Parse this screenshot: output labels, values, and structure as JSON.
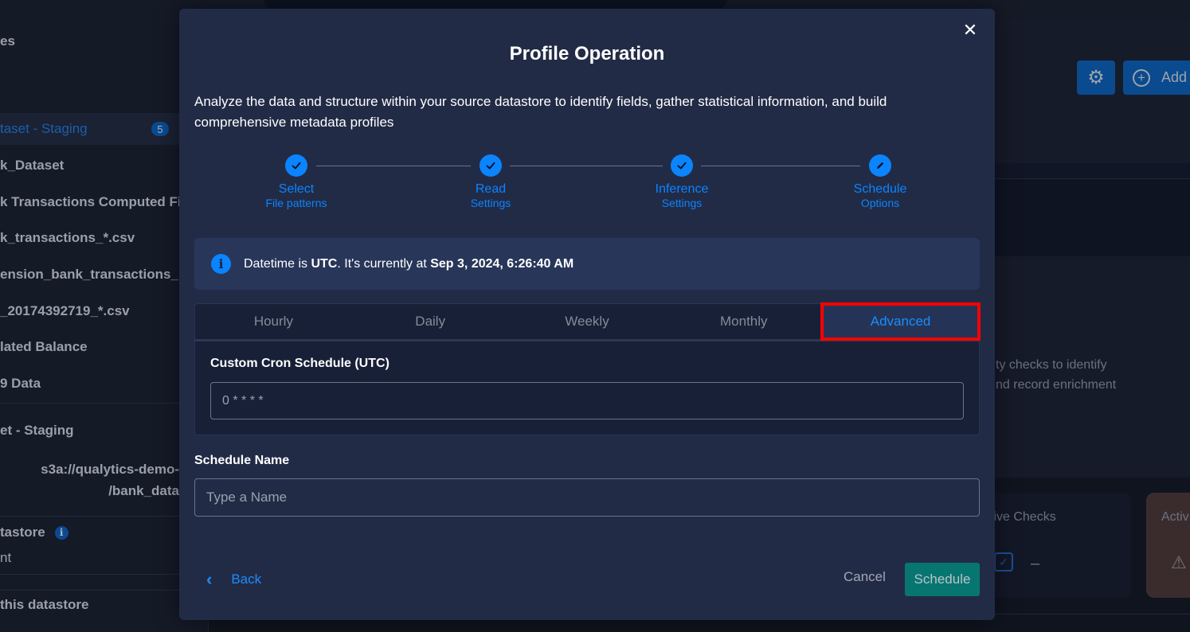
{
  "background": {
    "sidebar": {
      "items": [
        {
          "label": "es"
        },
        {
          "label": "taset - Staging",
          "badge": "5",
          "active": true
        },
        {
          "label": "k_Dataset"
        },
        {
          "label": "k Transactions Computed Fil"
        },
        {
          "label": "k_transactions_*.csv"
        },
        {
          "label": "ension_bank_transactions_"
        },
        {
          "label": "_20174392719_*.csv"
        },
        {
          "label": "lated Balance"
        },
        {
          "label": "9 Data"
        },
        {
          "label": "et - Staging"
        }
      ],
      "path_line1": "s3a://qualytics-demo-",
      "path_line2": "/bank_data",
      "datastore_label": "tastore",
      "datastore_value": "nt",
      "footer_label": "this datastore",
      "info_glyph": "i"
    },
    "toolbar": {
      "settings_icon": "gear-icon",
      "add_label": "Add"
    },
    "description_line1": "ty checks to identify",
    "description_line2": "nd record enrichment",
    "cards": [
      {
        "title": "ctive Checks",
        "value": "–",
        "icon": "checkbox-icon"
      },
      {
        "title": "Activ",
        "icon": "warning-icon"
      }
    ]
  },
  "modal": {
    "title": "Profile Operation",
    "close_glyph": "✕",
    "description": "Analyze the data and structure within your source datastore to identify fields, gather statistical information, and build comprehensive metadata profiles",
    "steps": [
      {
        "label": "Select",
        "sub": "File patterns",
        "status": "complete"
      },
      {
        "label": "Read",
        "sub": "Settings",
        "status": "complete"
      },
      {
        "label": "Inference",
        "sub": "Settings",
        "status": "complete"
      },
      {
        "label": "Schedule",
        "sub": "Options",
        "status": "current"
      }
    ],
    "info": {
      "prefix": "Datetime is ",
      "timezone": "UTC",
      "middle": ". It's currently at ",
      "datetime": "Sep 3, 2024, 6:26:40 AM"
    },
    "tabs": [
      {
        "label": "Hourly"
      },
      {
        "label": "Daily"
      },
      {
        "label": "Weekly"
      },
      {
        "label": "Monthly"
      },
      {
        "label": "Advanced",
        "active": true
      }
    ],
    "cron": {
      "label": "Custom Cron Schedule (UTC)",
      "value": "0 * * * *"
    },
    "schedule_name": {
      "label": "Schedule Name",
      "value": "",
      "placeholder": "Type a Name"
    },
    "footer": {
      "back_label": "Back",
      "cancel_label": "Cancel",
      "schedule_label": "Schedule"
    }
  },
  "colors": {
    "accent": "#0a84ff",
    "schedule_button": "#087670",
    "highlight_box": "#ff0000",
    "modal_bg": "#222b46"
  }
}
